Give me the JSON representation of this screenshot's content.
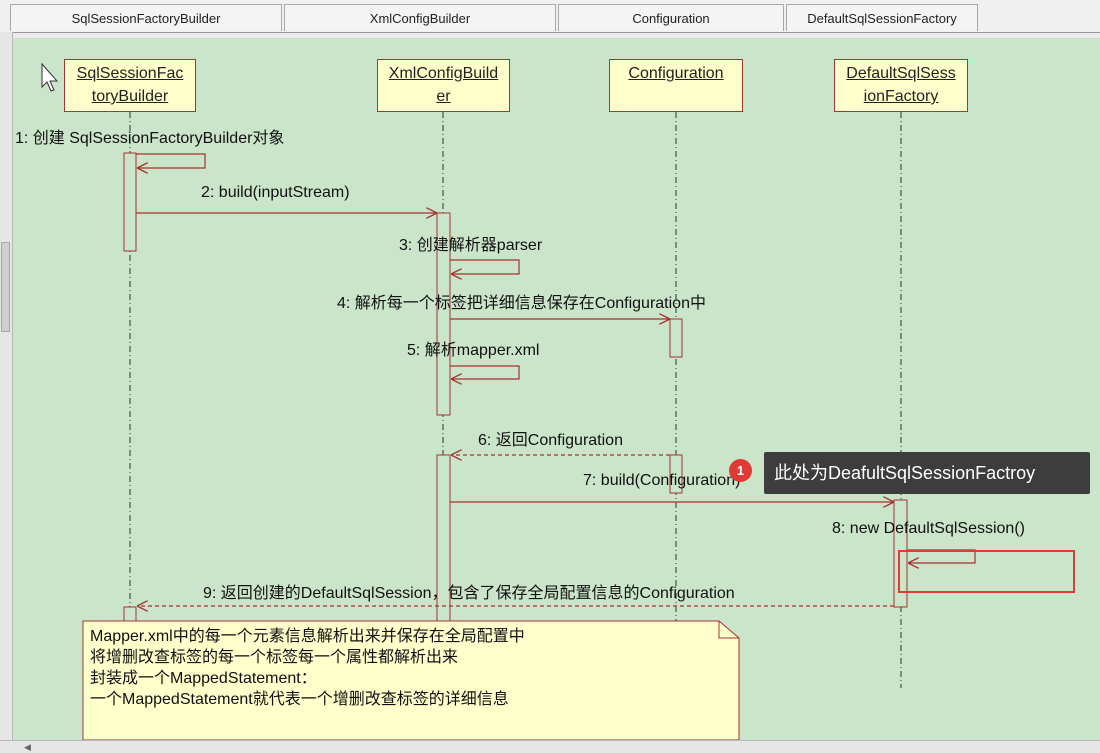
{
  "tabs": [
    {
      "label": "SqlSessionFactoryBuilder"
    },
    {
      "label": "XmlConfigBuilder"
    },
    {
      "label": "Configuration"
    },
    {
      "label": "DefaultSqlSessionFactory"
    }
  ],
  "lifelines": [
    {
      "line1": "SqlSessionFac",
      "line2": "toryBuilder"
    },
    {
      "line1": "XmlConfigBuild",
      "line2": "er"
    },
    {
      "line1": "Configuration",
      "line2": ""
    },
    {
      "line1": "DefaultSqlSess",
      "line2": "ionFactory"
    }
  ],
  "messages": [
    "1: 创建 SqlSessionFactoryBuilder对象",
    "2: build(inputStream)",
    "3: 创建解析器parser",
    "4: 解析每一个标签把详细信息保存在Configuration中",
    "5: 解析mapper.xml",
    "6: 返回Configuration",
    "7: build(Configuration)",
    "8: new DefaultSqlSession()",
    "9: 返回创建的DefaultSqlSession，包含了保存全局配置信息的Configuration"
  ],
  "note": {
    "lines": [
      "Mapper.xml中的每一个元素信息解析出来并保存在全局配置中",
      "将增删改查标签的每一个标签每一个属性都解析出来",
      "封装成一个MappedStatement：",
      "一个MappedStatement就代表一个增删改查标签的详细信息"
    ]
  },
  "annotation": {
    "badge": "1",
    "text": "此处为DeafultSqlSessionFactroy"
  },
  "colors": {
    "canvas": "#cae5c9",
    "box_fill": "#ffffcc",
    "line": "#a33333",
    "highlight": "#e03a35"
  }
}
